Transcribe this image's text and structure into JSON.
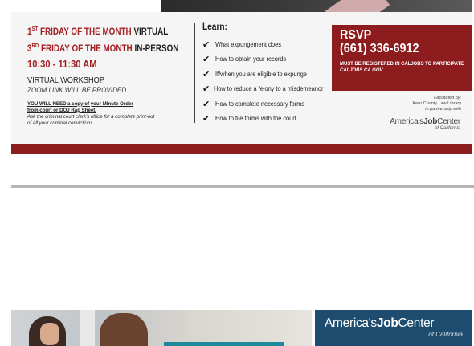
{
  "flyer": {
    "schedule": {
      "line1_ordinal": "1",
      "line1_sup": "ST",
      "line1_main": " FRIDAY OF THE MONTH ",
      "line1_mode": "VIRTUAL",
      "line2_ordinal": "3",
      "line2_sup": "RD",
      "line2_main": " FRIDAY OF THE MONTH ",
      "line2_mode": "IN-PERSON",
      "time": "10:30 - 11:30 AM"
    },
    "workshop_type": "VIRTUAL WORKSHOP",
    "zoom_note": "ZOOM LINK WILL BE PROVIDED",
    "requirements": {
      "line1": "YOU WILL NEED a copy of your Minute Order",
      "line2": "from court or DOJ Rap Sheet.",
      "line3": "Ask the criminal court clerk's office for a complete print-out",
      "line4": "of all your criminal convictions."
    },
    "learn": {
      "title": "Learn:",
      "items": [
        "What expungement does",
        "How to obtain your records",
        "If/when you are eligible to expunge",
        "How to reduce a felony to a misdemeanor",
        "How to complete necessary forms",
        "How to file forms with the court"
      ]
    },
    "rsvp": {
      "label": "RSVP",
      "phone": "(661) 336-6912",
      "note": "MUST BE REGISTERED IN CALJOBS TO PARTICIPATE",
      "site": "CALJOBS.CA.GOV"
    },
    "facilitated": {
      "line1": "Facilitated by:",
      "line2": "Kern County Law Library",
      "line3": "in partnership with"
    },
    "logo_small": {
      "prefix": "America's",
      "bold": "Job",
      "suffix": "Center",
      "sub": "of California"
    }
  },
  "banner": {
    "prefix": "America's",
    "bold": "Job",
    "suffix": "Center",
    "sub": "of California"
  },
  "colors": {
    "brand_red": "#8c1c1e",
    "schedule_red": "#a32024",
    "banner_blue": "#1e4c6e",
    "accent_teal": "#1d8a9a"
  }
}
